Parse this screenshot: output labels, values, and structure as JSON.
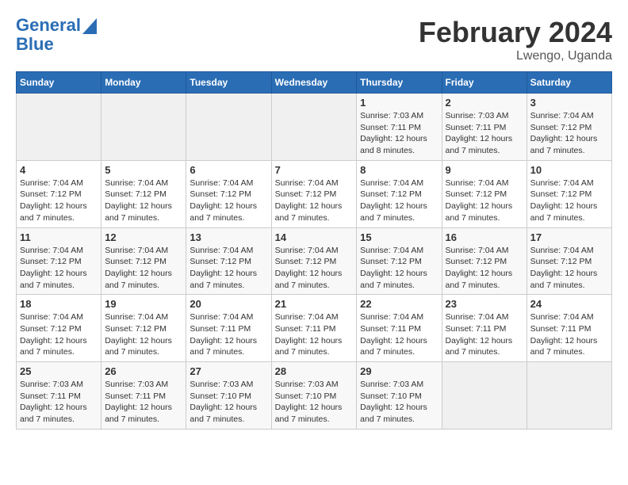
{
  "logo": {
    "line1": "General",
    "line2": "Blue"
  },
  "title": "February 2024",
  "location": "Lwengo, Uganda",
  "days_header": [
    "Sunday",
    "Monday",
    "Tuesday",
    "Wednesday",
    "Thursday",
    "Friday",
    "Saturday"
  ],
  "weeks": [
    [
      {
        "num": "",
        "info": ""
      },
      {
        "num": "",
        "info": ""
      },
      {
        "num": "",
        "info": ""
      },
      {
        "num": "",
        "info": ""
      },
      {
        "num": "1",
        "info": "Sunrise: 7:03 AM\nSunset: 7:11 PM\nDaylight: 12 hours\nand 8 minutes."
      },
      {
        "num": "2",
        "info": "Sunrise: 7:03 AM\nSunset: 7:11 PM\nDaylight: 12 hours\nand 7 minutes."
      },
      {
        "num": "3",
        "info": "Sunrise: 7:04 AM\nSunset: 7:12 PM\nDaylight: 12 hours\nand 7 minutes."
      }
    ],
    [
      {
        "num": "4",
        "info": "Sunrise: 7:04 AM\nSunset: 7:12 PM\nDaylight: 12 hours\nand 7 minutes."
      },
      {
        "num": "5",
        "info": "Sunrise: 7:04 AM\nSunset: 7:12 PM\nDaylight: 12 hours\nand 7 minutes."
      },
      {
        "num": "6",
        "info": "Sunrise: 7:04 AM\nSunset: 7:12 PM\nDaylight: 12 hours\nand 7 minutes."
      },
      {
        "num": "7",
        "info": "Sunrise: 7:04 AM\nSunset: 7:12 PM\nDaylight: 12 hours\nand 7 minutes."
      },
      {
        "num": "8",
        "info": "Sunrise: 7:04 AM\nSunset: 7:12 PM\nDaylight: 12 hours\nand 7 minutes."
      },
      {
        "num": "9",
        "info": "Sunrise: 7:04 AM\nSunset: 7:12 PM\nDaylight: 12 hours\nand 7 minutes."
      },
      {
        "num": "10",
        "info": "Sunrise: 7:04 AM\nSunset: 7:12 PM\nDaylight: 12 hours\nand 7 minutes."
      }
    ],
    [
      {
        "num": "11",
        "info": "Sunrise: 7:04 AM\nSunset: 7:12 PM\nDaylight: 12 hours\nand 7 minutes."
      },
      {
        "num": "12",
        "info": "Sunrise: 7:04 AM\nSunset: 7:12 PM\nDaylight: 12 hours\nand 7 minutes."
      },
      {
        "num": "13",
        "info": "Sunrise: 7:04 AM\nSunset: 7:12 PM\nDaylight: 12 hours\nand 7 minutes."
      },
      {
        "num": "14",
        "info": "Sunrise: 7:04 AM\nSunset: 7:12 PM\nDaylight: 12 hours\nand 7 minutes."
      },
      {
        "num": "15",
        "info": "Sunrise: 7:04 AM\nSunset: 7:12 PM\nDaylight: 12 hours\nand 7 minutes."
      },
      {
        "num": "16",
        "info": "Sunrise: 7:04 AM\nSunset: 7:12 PM\nDaylight: 12 hours\nand 7 minutes."
      },
      {
        "num": "17",
        "info": "Sunrise: 7:04 AM\nSunset: 7:12 PM\nDaylight: 12 hours\nand 7 minutes."
      }
    ],
    [
      {
        "num": "18",
        "info": "Sunrise: 7:04 AM\nSunset: 7:12 PM\nDaylight: 12 hours\nand 7 minutes."
      },
      {
        "num": "19",
        "info": "Sunrise: 7:04 AM\nSunset: 7:12 PM\nDaylight: 12 hours\nand 7 minutes."
      },
      {
        "num": "20",
        "info": "Sunrise: 7:04 AM\nSunset: 7:11 PM\nDaylight: 12 hours\nand 7 minutes."
      },
      {
        "num": "21",
        "info": "Sunrise: 7:04 AM\nSunset: 7:11 PM\nDaylight: 12 hours\nand 7 minutes."
      },
      {
        "num": "22",
        "info": "Sunrise: 7:04 AM\nSunset: 7:11 PM\nDaylight: 12 hours\nand 7 minutes."
      },
      {
        "num": "23",
        "info": "Sunrise: 7:04 AM\nSunset: 7:11 PM\nDaylight: 12 hours\nand 7 minutes."
      },
      {
        "num": "24",
        "info": "Sunrise: 7:04 AM\nSunset: 7:11 PM\nDaylight: 12 hours\nand 7 minutes."
      }
    ],
    [
      {
        "num": "25",
        "info": "Sunrise: 7:03 AM\nSunset: 7:11 PM\nDaylight: 12 hours\nand 7 minutes."
      },
      {
        "num": "26",
        "info": "Sunrise: 7:03 AM\nSunset: 7:11 PM\nDaylight: 12 hours\nand 7 minutes."
      },
      {
        "num": "27",
        "info": "Sunrise: 7:03 AM\nSunset: 7:10 PM\nDaylight: 12 hours\nand 7 minutes."
      },
      {
        "num": "28",
        "info": "Sunrise: 7:03 AM\nSunset: 7:10 PM\nDaylight: 12 hours\nand 7 minutes."
      },
      {
        "num": "29",
        "info": "Sunrise: 7:03 AM\nSunset: 7:10 PM\nDaylight: 12 hours\nand 7 minutes."
      },
      {
        "num": "",
        "info": ""
      },
      {
        "num": "",
        "info": ""
      }
    ]
  ]
}
